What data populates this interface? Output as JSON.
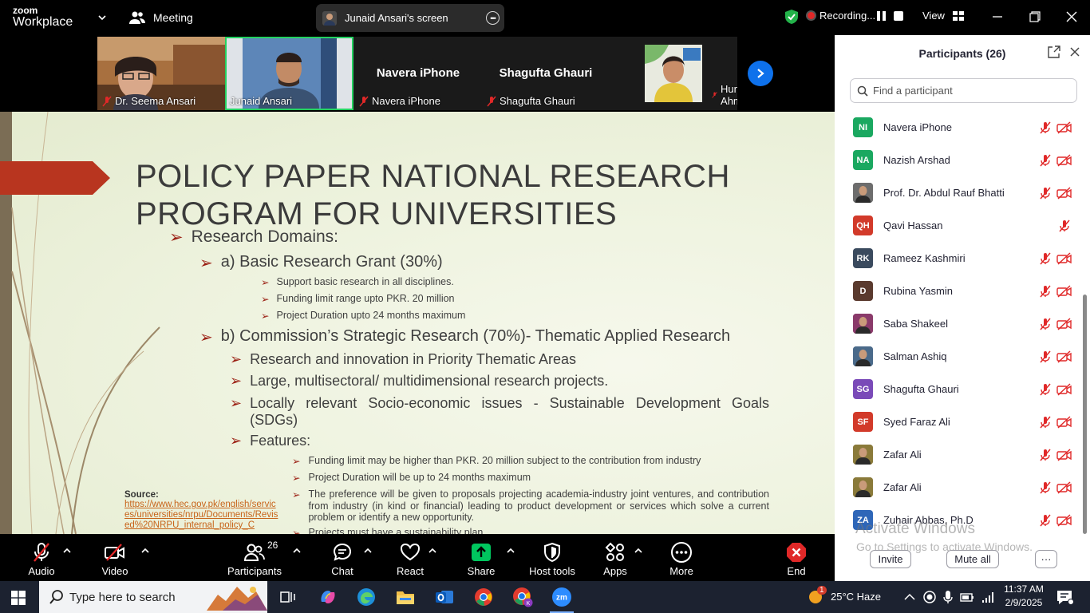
{
  "colors": {
    "zoom_blue": "#0e71eb",
    "share_green": "#00c65e",
    "recording_red": "#e02828",
    "slide_accent": "#b8351f",
    "source_link": "#c8641a",
    "end_red": "#e02828"
  },
  "titlebar": {
    "logo_line1": "zoom",
    "logo_line2": "Workplace",
    "meeting_label": "Meeting",
    "screen_share_label": "Junaid Ansari's screen",
    "recording_label": "Recording...",
    "view_label": "View"
  },
  "video_strip": {
    "tiles": [
      {
        "name": "Dr. Seema Ansari",
        "muted": true
      },
      {
        "name": "Junaid Ansari",
        "muted": false
      },
      {
        "name": "Navera iPhone",
        "center_name": "Navera iPhone",
        "muted": true
      },
      {
        "name": "Shagufta Ghauri",
        "center_name": "Shagufta Ghauri",
        "muted": true
      },
      {
        "name": "Huma Ahmed",
        "muted": true
      }
    ]
  },
  "slide": {
    "title_line1": "POLICY PAPER NATIONAL RESEARCH",
    "title_line2": "PROGRAM FOR UNIVERSITIES",
    "research_domains": "Research Domains:",
    "basic_grant": "a) Basic Research Grant (30%)",
    "basic_items": [
      "Support basic research in all disciplines.",
      "Funding limit range upto PKR. 20 million",
      "Project Duration upto 24 months maximum"
    ],
    "strategic": "b) Commission’s Strategic Research (70%)- Thematic Applied Research",
    "strategic_items": [
      "Research and innovation in Priority Thematic Areas",
      "Large, multisectoral/ multidimensional research projects.",
      "Locally relevant Socio-economic issues  - Sustainable Development Goals (SDGs)",
      "Features:"
    ],
    "feature_items": [
      "Funding limit may be higher than PKR. 20 million subject to the contribution from industry",
      "Project Duration will be up to 24 months maximum",
      "The preference will be given to proposals projecting academia-industry joint ventures, and contribution from industry (in kind or financial) leading to product development or services which solve a current problem or identify a new opportunity.",
      "Projects must have a sustainability plan"
    ],
    "source_label": "Source:",
    "source_link": "https://www.hec.gov.pk/english/services/universities/nrpu/Documents/Revised%20NRPU_internal_policy_C"
  },
  "participants_panel": {
    "title": "Participants (26)",
    "search_placeholder": "Find a participant",
    "participants": [
      {
        "initials": "NI",
        "name": "Navera iPhone",
        "color": "#1aa860",
        "photo": false,
        "video_off": true
      },
      {
        "initials": "NA",
        "name": "Nazish Arshad",
        "color": "#1aa860",
        "photo": false,
        "video_off": true
      },
      {
        "initials": "",
        "name": "Prof. Dr. Abdul Rauf Bhatti",
        "color": "#6d6d6d",
        "photo": true,
        "video_off": true
      },
      {
        "initials": "QH",
        "name": "Qavi Hassan",
        "color": "#d23a2a",
        "photo": false,
        "video_off": false
      },
      {
        "initials": "RK",
        "name": "Rameez Kashmiri",
        "color": "#3a4a5e",
        "photo": false,
        "video_off": true
      },
      {
        "initials": "D",
        "name": "Rubina Yasmin",
        "color": "#5a3a2e",
        "photo": false,
        "video_off": true
      },
      {
        "initials": "",
        "name": "Saba Shakeel",
        "color": "#8a3a6a",
        "photo": true,
        "video_off": true
      },
      {
        "initials": "",
        "name": "Salman Ashiq",
        "color": "#4a6a8a",
        "photo": true,
        "video_off": true
      },
      {
        "initials": "SG",
        "name": "Shagufta Ghauri",
        "color": "#7a4ab8",
        "photo": false,
        "video_off": true
      },
      {
        "initials": "SF",
        "name": "Syed Faraz Ali",
        "color": "#d23a2a",
        "photo": false,
        "video_off": true
      },
      {
        "initials": "",
        "name": "Zafar Ali",
        "color": "#8a7a3a",
        "photo": true,
        "video_off": true
      },
      {
        "initials": "",
        "name": "Zafar Ali",
        "color": "#8a7a3a",
        "photo": true,
        "video_off": true
      },
      {
        "initials": "ZA",
        "name": "Zuhair Abbas, Ph.D",
        "color": "#2e66b8",
        "photo": false,
        "video_off": true
      }
    ],
    "watermark_title": "Activate Windows",
    "watermark_sub": "Go to Settings to activate Windows.",
    "invite_label": "Invite",
    "mute_all_label": "Mute all",
    "more_label": "···"
  },
  "toolbar": {
    "audio": "Audio",
    "video": "Video",
    "participants": "Participants",
    "participants_count": "26",
    "chat": "Chat",
    "react": "React",
    "share": "Share",
    "host_tools": "Host tools",
    "apps": "Apps",
    "more": "More",
    "end": "End"
  },
  "taskbar": {
    "search_placeholder": "Type here to search",
    "weather": "25°C  Haze",
    "weather_badge": "1",
    "time": "11:37 AM",
    "date": "2/9/2025"
  }
}
